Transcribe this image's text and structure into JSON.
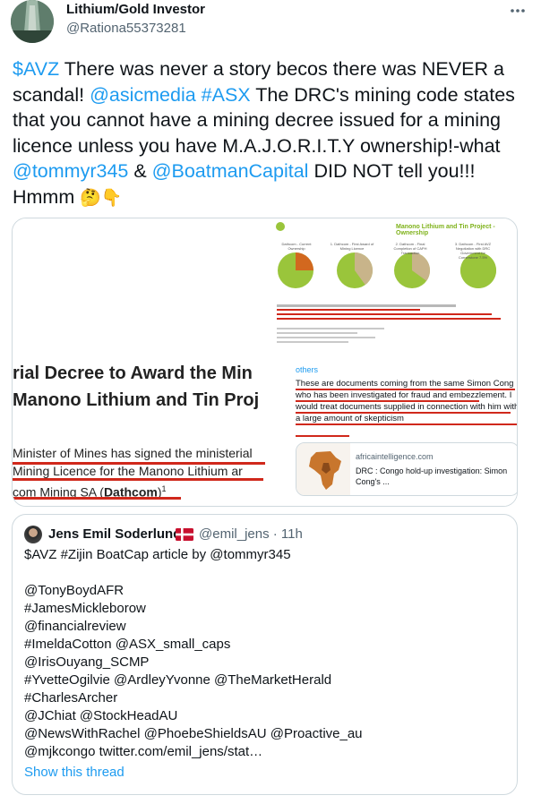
{
  "author": {
    "display_name": "Lithium/Gold Investor",
    "handle": "@Rationa55373281",
    "avatar_icon": "avatar-photo-icon",
    "more_icon": "more-dots-icon"
  },
  "tweet": {
    "parts": [
      {
        "text": "$AVZ",
        "link": true
      },
      {
        "text": " There was never a story becos there was NEVER a scandal! ",
        "link": false
      },
      {
        "text": "@asicmedia",
        "link": true
      },
      {
        "text": " ",
        "link": false
      },
      {
        "text": "#ASX",
        "link": true
      },
      {
        "text": " The DRC's mining code states that you cannot have a mining decree issued for a mining licence unless you have M.A.J.O.R.I.T.Y ownership!-what ",
        "link": false
      },
      {
        "text": "@tommyr345",
        "link": true
      },
      {
        "text": " & ",
        "link": false
      },
      {
        "text": "@BoatmanCapital",
        "link": true
      },
      {
        "text": " DID NOT tell you!!! Hmmm ",
        "link": false
      }
    ],
    "emojis": [
      "🤔",
      "👇"
    ]
  },
  "media": {
    "left_image": {
      "heading_line1": "rial Decree to Award the Min",
      "heading_line2": "Manono Lithium and Tin Proj",
      "body_line1": "Minister of Mines has signed the ministerial",
      "body_line2": "Mining Licence for the Manono Lithium ar",
      "body_line3_prefix": "com Mining SA (",
      "body_line3_bold": "Dathcom",
      "body_line3_suffix": ")",
      "body_line3_sup": "1"
    },
    "right_image": {
      "slide_title": "Manono Lithium and Tin Project - Ownership",
      "pie_captions": [
        "Dathcom - Current Ownership",
        "1. Dathcom - First Award of Mining Licence",
        "2. Dathcom - Final Completion of CAPH Transaction",
        "3. Dathcom - First AVZ Negotiation with DRC Government for Cornerstone 7.5%"
      ],
      "pie_shares": [
        0.25,
        0.4,
        0.35,
        0.85
      ],
      "colors": {
        "green": "#9ac53b",
        "orange": "#d2681f",
        "tan": "#c8b48a",
        "red": "#d0281b"
      },
      "reply_others": "others",
      "reply_text": "These are documents coming from the same Simon Cong who has been investigated for fraud and embezzlement. I would treat documents supplied in connection with him with a large amount of skepticism",
      "link_domain": "africaintelligence.com",
      "link_title": "DRC : Congo hold-up investigation: Simon Cong's ..."
    }
  },
  "quote": {
    "name": "Jens Emil Soderlund",
    "flag_icon": "denmark-flag-icon",
    "handle_time": "@emil_jens · 11h",
    "text": "$AVZ #Zijin BoatCap article by @tommyr345\n\n@TonyBoydAFR\n#JamesMickleborow\n@financialreview\n#ImeldaCotton @ASX_small_caps\n@IrisOuyang_SCMP\n#YvetteOgilvie @ArdleyYvonne @TheMarketHerald\n#CharlesArcher\n@JChiat @StockHeadAU\n@NewsWithRachel @PhoebeShieldsAU @Proactive_au\n@mjkcongo twitter.com/emil_jens/stat…",
    "show_thread": "Show this thread"
  }
}
